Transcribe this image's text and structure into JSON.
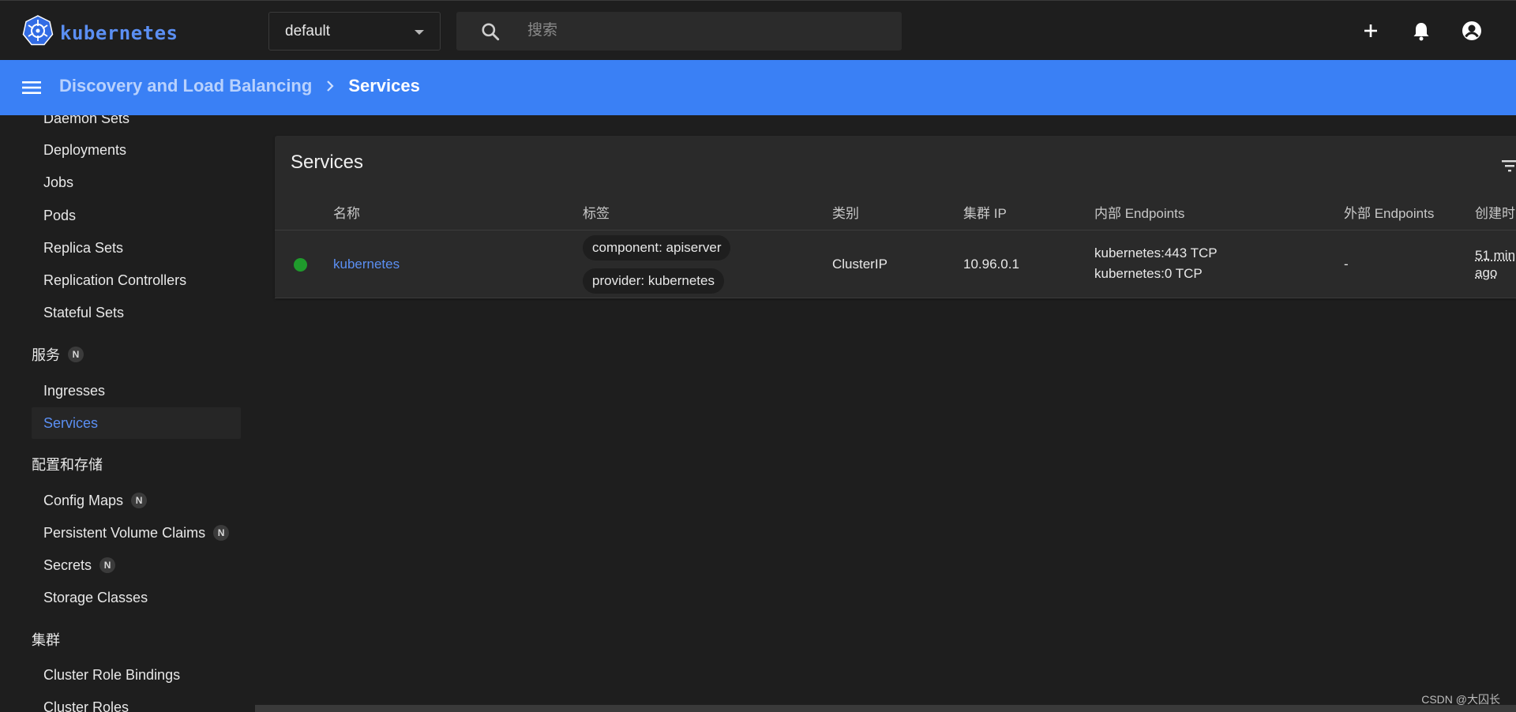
{
  "topbar": {
    "brand": "kubernetes",
    "namespace": "default",
    "search_placeholder": "搜索",
    "actions": [
      "add-icon",
      "bell-icon",
      "account-icon"
    ]
  },
  "header": {
    "breadcrumb_parent": "Discovery and Load Balancing",
    "breadcrumb_current": "Services"
  },
  "sidebar": {
    "workloads": [
      "Daemon Sets",
      "Deployments",
      "Jobs",
      "Pods",
      "Replica Sets",
      "Replication Controllers",
      "Stateful Sets"
    ],
    "services_group": "服务",
    "services_group_badge": "N",
    "services_items": [
      "Ingresses",
      "Services"
    ],
    "config_group": "配置和存储",
    "config_items": [
      {
        "label": "Config Maps",
        "badge": "N"
      },
      {
        "label": "Persistent Volume Claims",
        "badge": "N"
      },
      {
        "label": "Secrets",
        "badge": "N"
      },
      {
        "label": "Storage Classes",
        "badge": ""
      }
    ],
    "cluster_group": "集群",
    "cluster_items": [
      "Cluster Role Bindings",
      "Cluster Roles"
    ]
  },
  "services_card": {
    "title": "Services",
    "columns": [
      "名称",
      "标签",
      "类别",
      "集群 IP",
      "内部 Endpoints",
      "外部 Endpoints",
      "创建时"
    ],
    "rows": [
      {
        "status": "running",
        "name": "kubernetes",
        "labels": [
          "component: apiserver",
          "provider: kubernetes"
        ],
        "type": "ClusterIP",
        "cluster_ip": "10.96.0.1",
        "internal_endpoints": [
          "kubernetes:443 TCP",
          "kubernetes:0 TCP"
        ],
        "external_endpoints": "-",
        "created_line1": "51 min",
        "created_line2": "ago"
      }
    ]
  },
  "colors": {
    "header_blue": "#3a80f5",
    "link_blue": "#5b8ff3",
    "status_green": "#1f9b2c",
    "background": "#1e1e1e",
    "card": "#2a2a2a"
  },
  "watermark": "CSDN @大囚长"
}
